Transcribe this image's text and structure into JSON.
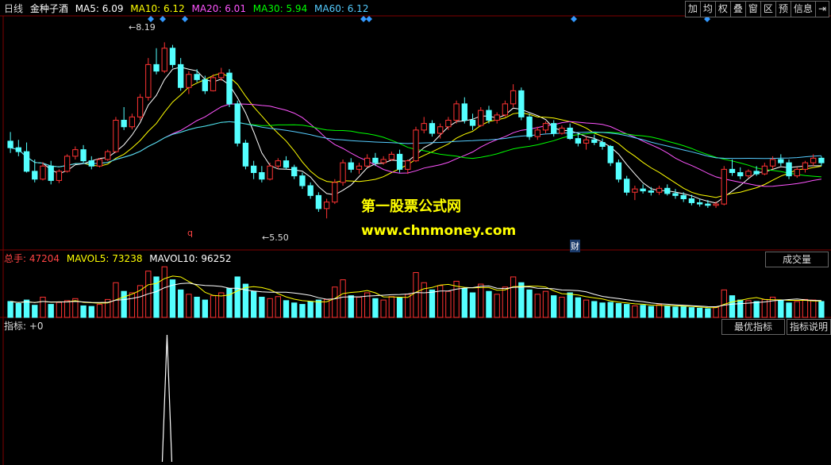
{
  "header": {
    "period": "日线",
    "stock_name": "金种子酒",
    "ma": [
      {
        "label": "MA5: 6.09",
        "color": "#ffffff"
      },
      {
        "label": "MA10: 6.12",
        "color": "#ffff00"
      },
      {
        "label": "MA20: 6.01",
        "color": "#ff55ff"
      },
      {
        "label": "MA30: 5.94",
        "color": "#00ff00"
      },
      {
        "label": "MA60: 6.12",
        "color": "#55ccff"
      }
    ]
  },
  "toolbar": [
    "加",
    "均",
    "权",
    "叠",
    "窗",
    "区",
    "预",
    "信息",
    "⇥"
  ],
  "price_labels": {
    "high": "8.19",
    "low": "5.50"
  },
  "markers": {
    "q": "q",
    "cai": "财"
  },
  "watermark": {
    "line1": "第一股票公式网",
    "line2": "www.chnmoney.com"
  },
  "volume_panel": {
    "total_label": "总手: 47204",
    "mavol5_label": "MAVOL5: 73238",
    "mavol10_label": "MAVOL10: 96252",
    "tab": "成交量"
  },
  "indicator_panel": {
    "label": "指标: +0",
    "best_tab": "最优指标",
    "explain_tab": "指标说明"
  },
  "colors": {
    "up": "#ff3333",
    "down": "#54ffff",
    "grid": "#800000",
    "diamond": "#3399ff"
  },
  "chart_data": {
    "type": "candlestick",
    "price_range": [
      5.2,
      8.4
    ],
    "ohlc": [
      [
        6.68,
        6.82,
        6.5,
        6.58
      ],
      [
        6.58,
        6.7,
        6.45,
        6.52
      ],
      [
        6.52,
        6.66,
        6.2,
        6.22
      ],
      [
        6.22,
        6.4,
        6.05,
        6.1
      ],
      [
        6.1,
        6.36,
        6.08,
        6.3
      ],
      [
        6.3,
        6.38,
        6.02,
        6.08
      ],
      [
        6.08,
        6.25,
        6.04,
        6.22
      ],
      [
        6.22,
        6.48,
        6.2,
        6.45
      ],
      [
        6.45,
        6.6,
        6.4,
        6.55
      ],
      [
        6.55,
        6.62,
        6.35,
        6.38
      ],
      [
        6.38,
        6.45,
        6.25,
        6.3
      ],
      [
        6.3,
        6.42,
        6.28,
        6.4
      ],
      [
        6.4,
        6.55,
        6.38,
        6.52
      ],
      [
        6.52,
        7.05,
        6.5,
        7.0
      ],
      [
        7.0,
        7.2,
        6.85,
        6.9
      ],
      [
        6.9,
        7.1,
        6.86,
        7.05
      ],
      [
        7.05,
        7.4,
        7.0,
        7.35
      ],
      [
        7.35,
        7.95,
        7.3,
        7.85
      ],
      [
        7.85,
        8.1,
        7.7,
        7.75
      ],
      [
        7.75,
        8.19,
        7.72,
        8.1
      ],
      [
        8.1,
        8.15,
        7.8,
        7.85
      ],
      [
        7.85,
        7.95,
        7.45,
        7.5
      ],
      [
        7.5,
        7.75,
        7.4,
        7.7
      ],
      [
        7.7,
        7.78,
        7.58,
        7.62
      ],
      [
        7.62,
        7.68,
        7.4,
        7.45
      ],
      [
        7.45,
        7.7,
        7.44,
        7.65
      ],
      [
        7.65,
        7.8,
        7.6,
        7.72
      ],
      [
        7.72,
        7.78,
        7.2,
        7.25
      ],
      [
        7.25,
        7.3,
        6.6,
        6.65
      ],
      [
        6.65,
        6.7,
        6.25,
        6.3
      ],
      [
        6.3,
        6.38,
        6.1,
        6.2
      ],
      [
        6.2,
        6.3,
        6.05,
        6.1
      ],
      [
        6.1,
        6.35,
        6.08,
        6.3
      ],
      [
        6.3,
        6.42,
        6.25,
        6.38
      ],
      [
        6.38,
        6.45,
        6.25,
        6.28
      ],
      [
        6.28,
        6.32,
        6.1,
        6.15
      ],
      [
        6.15,
        6.2,
        5.95,
        6.0
      ],
      [
        6.0,
        6.05,
        5.8,
        5.85
      ],
      [
        5.85,
        5.9,
        5.6,
        5.65
      ],
      [
        5.65,
        5.8,
        5.5,
        5.75
      ],
      [
        5.75,
        6.1,
        5.72,
        6.05
      ],
      [
        6.05,
        6.4,
        6.0,
        6.35
      ],
      [
        6.35,
        6.42,
        6.2,
        6.25
      ],
      [
        6.25,
        6.35,
        6.18,
        6.3
      ],
      [
        6.3,
        6.48,
        6.28,
        6.42
      ],
      [
        6.42,
        6.5,
        6.3,
        6.35
      ],
      [
        6.35,
        6.45,
        6.32,
        6.4
      ],
      [
        6.4,
        6.52,
        6.38,
        6.48
      ],
      [
        6.48,
        6.55,
        6.2,
        6.25
      ],
      [
        6.25,
        6.4,
        6.18,
        6.38
      ],
      [
        6.38,
        6.9,
        6.36,
        6.85
      ],
      [
        6.85,
        7.05,
        6.8,
        6.95
      ],
      [
        6.95,
        7.0,
        6.75,
        6.8
      ],
      [
        6.8,
        6.95,
        6.72,
        6.9
      ],
      [
        6.9,
        7.05,
        6.85,
        7.0
      ],
      [
        7.0,
        7.3,
        6.95,
        7.25
      ],
      [
        7.25,
        7.35,
        6.95,
        7.0
      ],
      [
        7.0,
        7.1,
        6.85,
        6.92
      ],
      [
        6.92,
        7.2,
        6.9,
        7.15
      ],
      [
        7.15,
        7.22,
        6.95,
        7.0
      ],
      [
        7.0,
        7.12,
        6.95,
        7.08
      ],
      [
        7.08,
        7.3,
        7.05,
        7.25
      ],
      [
        7.25,
        7.55,
        7.2,
        7.45
      ],
      [
        7.45,
        7.5,
        7.0,
        7.05
      ],
      [
        7.05,
        7.1,
        6.7,
        6.75
      ],
      [
        6.75,
        6.9,
        6.7,
        6.85
      ],
      [
        6.85,
        6.98,
        6.8,
        6.95
      ],
      [
        6.95,
        7.0,
        6.75,
        6.8
      ],
      [
        6.8,
        6.92,
        6.78,
        6.88
      ],
      [
        6.88,
        6.95,
        6.7,
        6.72
      ],
      [
        6.72,
        6.8,
        6.6,
        6.65
      ],
      [
        6.65,
        6.75,
        6.55,
        6.7
      ],
      [
        6.7,
        6.78,
        6.62,
        6.66
      ],
      [
        6.66,
        6.72,
        6.55,
        6.6
      ],
      [
        6.6,
        6.62,
        6.3,
        6.35
      ],
      [
        6.35,
        6.4,
        6.05,
        6.1
      ],
      [
        6.1,
        6.15,
        5.85,
        5.9
      ],
      [
        5.9,
        6.0,
        5.78,
        5.95
      ],
      [
        5.95,
        6.02,
        5.88,
        5.92
      ],
      [
        5.92,
        5.98,
        5.85,
        5.9
      ],
      [
        5.9,
        6.0,
        5.86,
        5.96
      ],
      [
        5.96,
        6.02,
        5.85,
        5.88
      ],
      [
        5.88,
        5.95,
        5.8,
        5.85
      ],
      [
        5.85,
        5.9,
        5.75,
        5.8
      ],
      [
        5.8,
        5.86,
        5.7,
        5.74
      ],
      [
        5.74,
        5.8,
        5.68,
        5.72
      ],
      [
        5.72,
        5.78,
        5.66,
        5.7
      ],
      [
        5.7,
        5.76,
        5.66,
        5.72
      ],
      [
        5.72,
        6.3,
        5.7,
        6.25
      ],
      [
        6.25,
        6.4,
        6.15,
        6.2
      ],
      [
        6.2,
        6.28,
        6.1,
        6.15
      ],
      [
        6.15,
        6.25,
        6.12,
        6.22
      ],
      [
        6.22,
        6.3,
        6.15,
        6.18
      ],
      [
        6.18,
        6.35,
        6.16,
        6.3
      ],
      [
        6.3,
        6.45,
        6.25,
        6.4
      ],
      [
        6.4,
        6.48,
        6.3,
        6.35
      ],
      [
        6.35,
        6.4,
        6.1,
        6.15
      ],
      [
        6.15,
        6.28,
        6.12,
        6.25
      ],
      [
        6.25,
        6.38,
        6.2,
        6.35
      ],
      [
        6.35,
        6.48,
        6.3,
        6.42
      ],
      [
        6.42,
        6.45,
        6.3,
        6.35
      ]
    ],
    "volume": [
      55,
      48,
      60,
      42,
      70,
      45,
      52,
      58,
      65,
      40,
      38,
      45,
      62,
      120,
      90,
      85,
      110,
      160,
      140,
      175,
      130,
      95,
      80,
      70,
      60,
      75,
      85,
      100,
      140,
      115,
      90,
      70,
      65,
      72,
      58,
      50,
      45,
      55,
      60,
      62,
      105,
      130,
      75,
      70,
      85,
      65,
      60,
      72,
      68,
      80,
      155,
      120,
      95,
      110,
      90,
      125,
      100,
      85,
      115,
      90,
      80,
      105,
      140,
      120,
      95,
      80,
      90,
      75,
      70,
      85,
      68,
      60,
      55,
      50,
      52,
      48,
      45,
      40,
      42,
      38,
      44,
      40,
      36,
      38,
      34,
      32,
      30,
      35,
      95,
      75,
      60,
      58,
      55,
      62,
      70,
      58,
      50,
      55,
      62,
      60,
      55
    ],
    "ma_lines": [
      "MA5",
      "MA10",
      "MA20",
      "MA30",
      "MA60"
    ],
    "indicator_spike_index": 20
  }
}
